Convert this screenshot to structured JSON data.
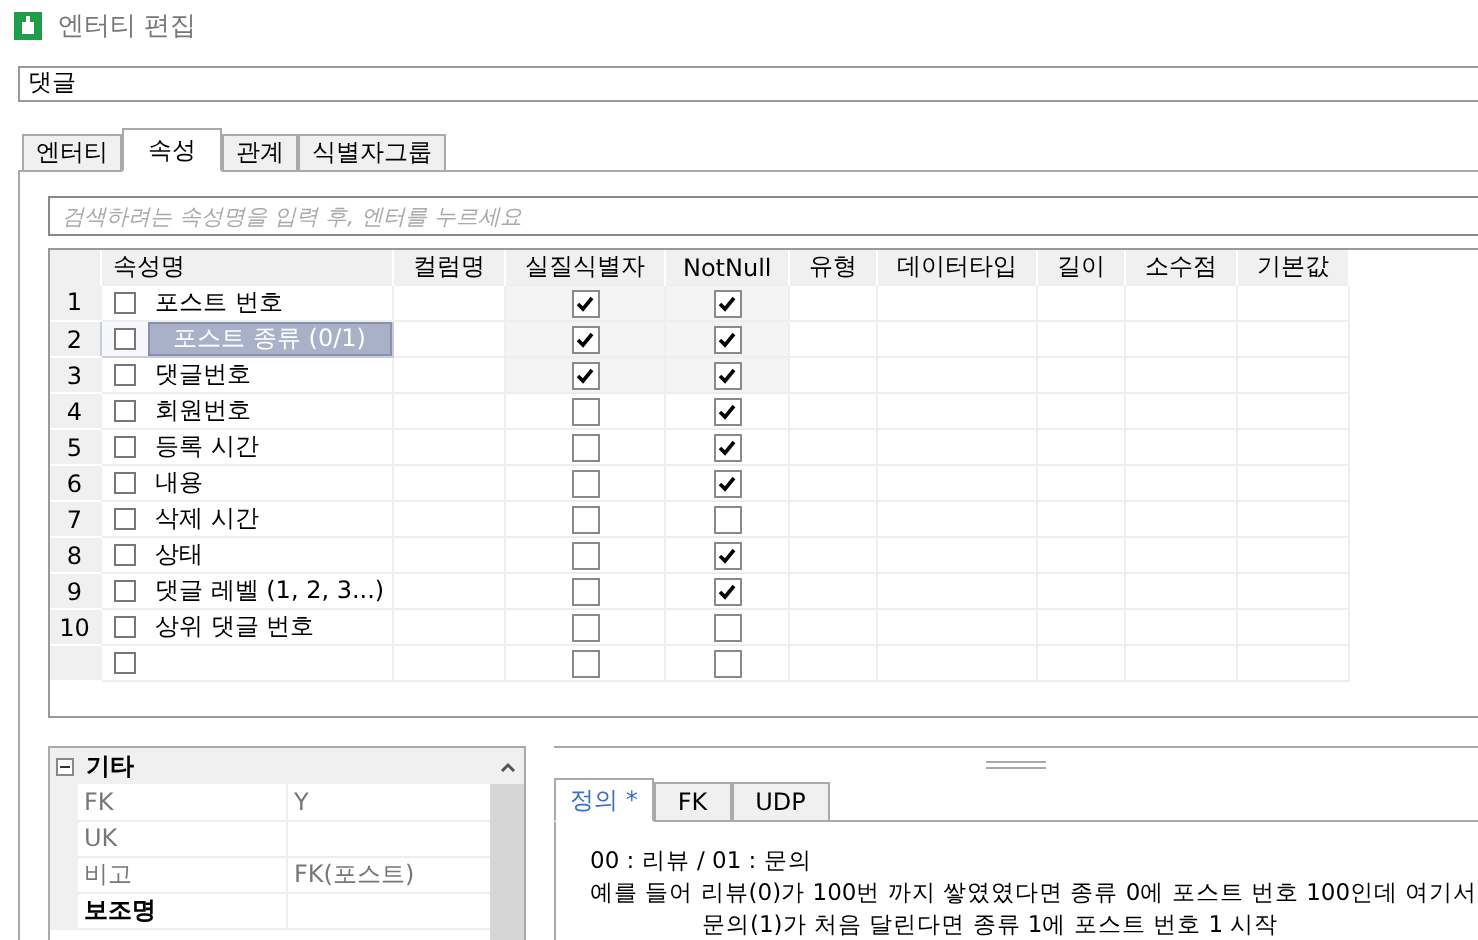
{
  "window": {
    "title": "엔터티 편집"
  },
  "entity_name": {
    "value": "댓글"
  },
  "tabs": [
    {
      "label": "엔터티",
      "selected": false
    },
    {
      "label": "속성",
      "selected": true
    },
    {
      "label": "관계",
      "selected": false
    },
    {
      "label": "식별자그룹",
      "selected": false
    }
  ],
  "search": {
    "placeholder": "검색하려는 속성명을 입력 후, 엔터를 누르세요"
  },
  "table": {
    "columns": [
      "속성명",
      "컬럼명",
      "실질식별자",
      "NotNull",
      "유형",
      "데이터타입",
      "길이",
      "소수점",
      "기본값"
    ],
    "rows": [
      {
        "number": "1",
        "name": "포스트 번호",
        "marked": false,
        "selected": false,
        "identifier": true,
        "not_null": true
      },
      {
        "number": "2",
        "name": "포스트 종류 (0/1)",
        "marked": false,
        "selected": true,
        "identifier": true,
        "not_null": true
      },
      {
        "number": "3",
        "name": "댓글번호",
        "marked": false,
        "selected": false,
        "identifier": true,
        "not_null": true
      },
      {
        "number": "4",
        "name": "회원번호",
        "marked": false,
        "selected": false,
        "identifier": false,
        "not_null": true
      },
      {
        "number": "5",
        "name": "등록 시간",
        "marked": false,
        "selected": false,
        "identifier": false,
        "not_null": true
      },
      {
        "number": "6",
        "name": "내용",
        "marked": false,
        "selected": false,
        "identifier": false,
        "not_null": true
      },
      {
        "number": "7",
        "name": "삭제 시간",
        "marked": false,
        "selected": false,
        "identifier": false,
        "not_null": false
      },
      {
        "number": "8",
        "name": "상태",
        "marked": false,
        "selected": false,
        "identifier": false,
        "not_null": true
      },
      {
        "number": "9",
        "name": "댓글 레벨 (1, 2, 3...)",
        "marked": false,
        "selected": false,
        "identifier": false,
        "not_null": true
      },
      {
        "number": "10",
        "name": "상위 댓글 번호",
        "marked": false,
        "selected": false,
        "identifier": false,
        "not_null": false
      },
      {
        "marked": false,
        "selected": false,
        "identifier": false,
        "not_null": false
      }
    ]
  },
  "properties": {
    "group": {
      "label": "기타",
      "expanded": true
    },
    "rows": [
      {
        "key": "FK",
        "value": "Y",
        "kind": "plain"
      },
      {
        "key": "UK",
        "kind": "plain"
      },
      {
        "key": "비고",
        "value": "FK(포스트)",
        "kind": "plain"
      },
      {
        "key": "보조명",
        "kind": "bold"
      }
    ]
  },
  "detail_tabs": [
    {
      "label": "정의 *",
      "selected": true
    },
    {
      "label": "FK",
      "selected": false
    },
    {
      "label": "UDP",
      "selected": false
    }
  ],
  "definition": {
    "lines": [
      {
        "text": "00 : 리뷰 / 01 : 문의",
        "kind": "line"
      },
      {
        "text": "예를 들어 리뷰(0)가 100번 까지 쌓였였다면 종류 0에 포스트 번호 100인데 여기서",
        "kind": "line"
      },
      {
        "text": "문의(1)가 처음 달린다면 종류 1에 포스트 번호 1 시작",
        "kind": "continuation"
      }
    ]
  }
}
